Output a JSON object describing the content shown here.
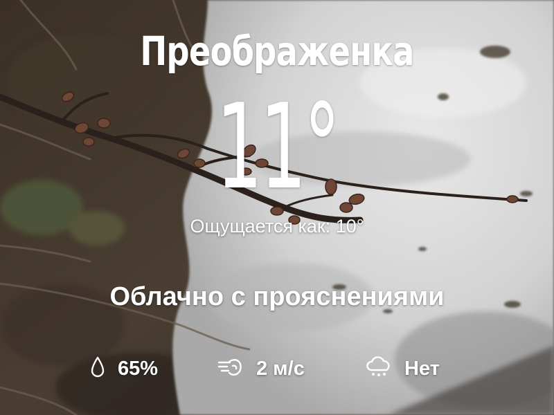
{
  "weather": {
    "city": "Преображенка",
    "temperature": "11°",
    "feels_like": "Ощущается как: 10°",
    "condition": "Облачно с прояснениями",
    "humidity": "65%",
    "wind": "2 м/с",
    "precipitation": "Нет"
  },
  "icons": {
    "humidity": "water-drop-icon",
    "wind": "wind-icon",
    "precipitation": "cloud-rain-icon"
  },
  "colors": {
    "text": "#ffffff",
    "snow": "#dcdcdc",
    "ground": "#3a3128"
  }
}
